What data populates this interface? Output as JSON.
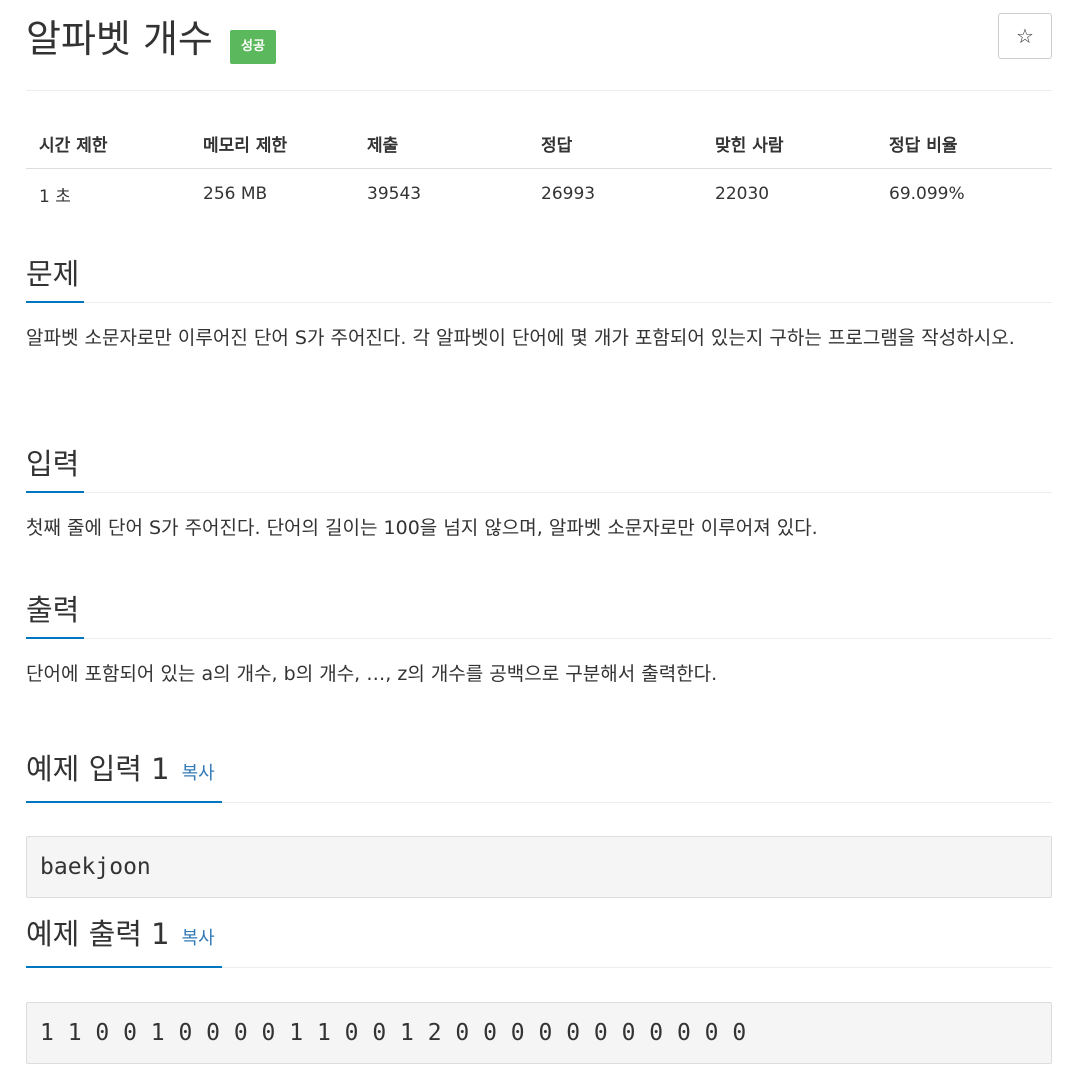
{
  "problem": {
    "title": "알파벳 개수",
    "status_badge": "성공",
    "star_icon": "star-icon",
    "star_glyph": "☆"
  },
  "info_table": {
    "headers": [
      "시간 제한",
      "메모리 제한",
      "제출",
      "정답",
      "맞힌 사람",
      "정답 비율"
    ],
    "values": [
      "1 초",
      "256 MB",
      "39543",
      "26993",
      "22030",
      "69.099%"
    ]
  },
  "sections": {
    "problem": {
      "heading": "문제",
      "text": "알파벳 소문자로만 이루어진 단어 S가 주어진다. 각 알파벳이 단어에 몇 개가 포함되어 있는지 구하는 프로그램을 작성하시오."
    },
    "input": {
      "heading": "입력",
      "text": "첫째 줄에 단어 S가 주어진다. 단어의 길이는 100을 넘지 않으며, 알파벳 소문자로만 이루어져 있다."
    },
    "output": {
      "heading": "출력",
      "text": "단어에 포함되어 있는 a의 개수, b의 개수, …, z의 개수를 공백으로 구분해서 출력한다."
    }
  },
  "samples": {
    "input_1": {
      "heading": "예제 입력 1",
      "copy_label": "복사",
      "content": "baekjoon"
    },
    "output_1": {
      "heading": "예제 출력 1",
      "copy_label": "복사",
      "content": "1 1 0 0 1 0 0 0 0 1 1 0 0 1 2 0 0 0 0 0 0 0 0 0 0 0"
    }
  },
  "colors": {
    "badge_success": "#5cb85c",
    "heading_underline": "#0076c0",
    "link": "#337ab7"
  }
}
